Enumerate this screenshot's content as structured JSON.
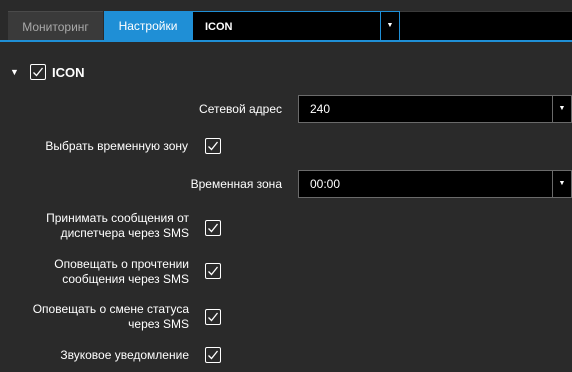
{
  "tabs": {
    "monitoring": "Мониторинг",
    "settings": "Настройки"
  },
  "device_select": {
    "value": "ICON"
  },
  "section": {
    "title": "ICON",
    "checked": true
  },
  "fields": {
    "network_address": {
      "label": "Сетевой адрес",
      "value": "240"
    },
    "select_timezone": {
      "label": "Выбрать временную зону",
      "checked": true
    },
    "timezone": {
      "label": "Временная зона",
      "value": "00:00"
    },
    "accept_sms_line1": "Принимать сообщения от",
    "accept_sms_line2": "диспетчера через SMS",
    "notify_read_line1": "Оповещать о прочтении",
    "notify_read_line2": "сообщения через SMS",
    "notify_status_line1": "Оповещать о смене статуса",
    "notify_status_line2": "через SMS",
    "sound_notification": "Звуковое уведомление"
  },
  "icons": {
    "collapse": "triangle-down-icon",
    "dropdown": "triangle-down-icon",
    "check": "checkmark-icon"
  },
  "colors": {
    "accent": "#1f8fd6",
    "background": "#2a2a2a",
    "field_background": "#000000"
  }
}
